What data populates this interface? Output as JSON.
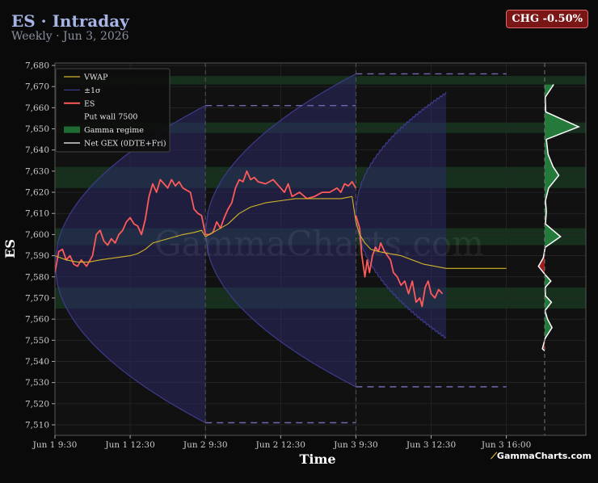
{
  "header": {
    "title": "ES · Intraday",
    "subtitle": "Weekly · Jun 3, 2026",
    "change_badge": "CHG -0.50%"
  },
  "watermark": "GammaCharts.com",
  "brand": {
    "spark": "⟋",
    "name": "GammaCharts.com"
  },
  "colors": {
    "background": "#0a0a0a",
    "plot_bg": "#111111",
    "price": "#ff5a5a",
    "vwap": "#d4b429",
    "sigma": "#3d3b8c",
    "sigma_fill": "#2c2a66",
    "gamma": "#1f6b34",
    "gex_pos": "#237a3a",
    "gex_neg": "#a01c1c"
  },
  "chart_data": {
    "type": "line",
    "xlabel": "Time",
    "ylabel": "ES",
    "ylim": [
      7505,
      7683
    ],
    "y_ticks": [
      7510,
      7520,
      7530,
      7540,
      7550,
      7560,
      7570,
      7580,
      7590,
      7600,
      7610,
      7620,
      7630,
      7640,
      7650,
      7660,
      7670,
      7680
    ],
    "x_ticks": [
      {
        "label": "Jun 1 9:30",
        "t": 0
      },
      {
        "label": "Jun 1 12:30",
        "t": 1
      },
      {
        "label": "Jun 2 9:30",
        "t": 2
      },
      {
        "label": "Jun 2 12:30",
        "t": 3
      },
      {
        "label": "Jun 3 9:30",
        "t": 4
      },
      {
        "label": "Jun 3 12:30",
        "t": 5
      },
      {
        "label": "Jun 3 16:00",
        "t": 6
      }
    ],
    "grid": true,
    "legend": {
      "position": "top-left",
      "entries": [
        {
          "label": "VWAP",
          "kind": "line",
          "color": "#d4b429"
        },
        {
          "label": "±1σ",
          "kind": "line",
          "color": "#3d3b8c"
        },
        {
          "label": "ES",
          "kind": "line",
          "color": "#ff5a5a"
        },
        {
          "label": "Put wall 7500",
          "kind": "none",
          "color": "#000000"
        },
        {
          "label": "Gamma regime",
          "kind": "patch",
          "color": "#1f6b34"
        },
        {
          "label": "Net GEX (0DTE+Fri)",
          "kind": "line",
          "color": "#ffffff"
        }
      ]
    },
    "session_breaks": [
      2,
      4
    ],
    "gamma_bands": [
      [
        7671,
        7675
      ],
      [
        7648,
        7653
      ],
      [
        7622,
        7632
      ],
      [
        7595,
        7603
      ],
      [
        7565,
        7575
      ]
    ],
    "sigma_cones": [
      {
        "t0": 0,
        "t1": 2,
        "center": 7586,
        "upper_end": 7661,
        "lower_end": 7511
      },
      {
        "t0": 2,
        "t1": 4,
        "center": 7601,
        "upper_end": 7676,
        "lower_end": 7528
      },
      {
        "t0": 4,
        "t1": 5.2,
        "center": 7610,
        "upper_end": 7667,
        "lower_end": 7551
      }
    ],
    "sigma_levels": [
      {
        "t0": 2,
        "t1": 4,
        "value": 7661
      },
      {
        "t0": 2,
        "t1": 4,
        "value": 7511
      },
      {
        "t0": 4,
        "t1": 6,
        "value": 7676
      },
      {
        "t0": 4,
        "t1": 6,
        "value": 7528
      }
    ],
    "series": [
      {
        "name": "ES",
        "points": [
          [
            0,
            7582
          ],
          [
            0.05,
            7592
          ],
          [
            0.1,
            7593
          ],
          [
            0.15,
            7588
          ],
          [
            0.2,
            7590
          ],
          [
            0.25,
            7586
          ],
          [
            0.3,
            7585
          ],
          [
            0.35,
            7588
          ],
          [
            0.42,
            7585
          ],
          [
            0.5,
            7590
          ],
          [
            0.55,
            7600
          ],
          [
            0.6,
            7602
          ],
          [
            0.65,
            7597
          ],
          [
            0.7,
            7595
          ],
          [
            0.75,
            7598
          ],
          [
            0.8,
            7596
          ],
          [
            0.85,
            7600
          ],
          [
            0.9,
            7602
          ],
          [
            0.95,
            7606
          ],
          [
            1.0,
            7608
          ],
          [
            1.05,
            7605
          ],
          [
            1.1,
            7604
          ],
          [
            1.15,
            7600
          ],
          [
            1.2,
            7607
          ],
          [
            1.25,
            7618
          ],
          [
            1.3,
            7624
          ],
          [
            1.35,
            7620
          ],
          [
            1.4,
            7626
          ],
          [
            1.45,
            7624
          ],
          [
            1.5,
            7622
          ],
          [
            1.55,
            7626
          ],
          [
            1.6,
            7623
          ],
          [
            1.65,
            7625
          ],
          [
            1.7,
            7622
          ],
          [
            1.8,
            7620
          ],
          [
            1.85,
            7612
          ],
          [
            1.9,
            7610
          ],
          [
            1.95,
            7609
          ],
          [
            2.0,
            7600
          ],
          [
            2.05,
            7600
          ],
          [
            2.1,
            7601
          ],
          [
            2.15,
            7606
          ],
          [
            2.2,
            7603
          ],
          [
            2.25,
            7608
          ],
          [
            2.3,
            7612
          ],
          [
            2.35,
            7615
          ],
          [
            2.4,
            7622
          ],
          [
            2.45,
            7626
          ],
          [
            2.5,
            7625
          ],
          [
            2.55,
            7630
          ],
          [
            2.6,
            7626
          ],
          [
            2.65,
            7627
          ],
          [
            2.7,
            7625
          ],
          [
            2.8,
            7624
          ],
          [
            2.9,
            7626
          ],
          [
            3.0,
            7622
          ],
          [
            3.05,
            7620
          ],
          [
            3.1,
            7624
          ],
          [
            3.15,
            7618
          ],
          [
            3.25,
            7620
          ],
          [
            3.35,
            7617
          ],
          [
            3.45,
            7618
          ],
          [
            3.55,
            7620
          ],
          [
            3.65,
            7620
          ],
          [
            3.75,
            7622
          ],
          [
            3.8,
            7620
          ],
          [
            3.85,
            7624
          ],
          [
            3.9,
            7623
          ],
          [
            3.95,
            7625
          ],
          [
            4.0,
            7622
          ],
          [
            4.0,
            7609
          ],
          [
            4.05,
            7603
          ],
          [
            4.08,
            7590
          ],
          [
            4.12,
            7580
          ],
          [
            4.15,
            7588
          ],
          [
            4.18,
            7582
          ],
          [
            4.22,
            7590
          ],
          [
            4.26,
            7594
          ],
          [
            4.3,
            7592
          ],
          [
            4.33,
            7596
          ],
          [
            4.38,
            7592
          ],
          [
            4.42,
            7590
          ],
          [
            4.46,
            7588
          ],
          [
            4.5,
            7582
          ],
          [
            4.55,
            7580
          ],
          [
            4.6,
            7576
          ],
          [
            4.65,
            7578
          ],
          [
            4.7,
            7572
          ],
          [
            4.75,
            7578
          ],
          [
            4.8,
            7568
          ],
          [
            4.85,
            7570
          ],
          [
            4.88,
            7566
          ],
          [
            4.92,
            7575
          ],
          [
            4.96,
            7578
          ],
          [
            5.0,
            7572
          ],
          [
            5.05,
            7570
          ],
          [
            5.1,
            7574
          ],
          [
            5.15,
            7572
          ]
        ]
      },
      {
        "name": "VWAP",
        "points": [
          [
            0,
            7590
          ],
          [
            0.15,
            7588
          ],
          [
            0.3,
            7587
          ],
          [
            0.45,
            7587
          ],
          [
            0.6,
            7588
          ],
          [
            0.8,
            7589
          ],
          [
            1.0,
            7590
          ],
          [
            1.1,
            7591
          ],
          [
            1.2,
            7593
          ],
          [
            1.3,
            7596
          ],
          [
            1.5,
            7598
          ],
          [
            1.7,
            7600
          ],
          [
            1.85,
            7601
          ],
          [
            1.95,
            7602
          ],
          [
            2.0,
            7599
          ],
          [
            2.15,
            7602
          ],
          [
            2.3,
            7605
          ],
          [
            2.45,
            7610
          ],
          [
            2.6,
            7613
          ],
          [
            2.8,
            7615
          ],
          [
            3.0,
            7616
          ],
          [
            3.2,
            7617
          ],
          [
            3.4,
            7617
          ],
          [
            3.6,
            7617
          ],
          [
            3.8,
            7617
          ],
          [
            3.95,
            7618
          ],
          [
            4.0,
            7606
          ],
          [
            4.05,
            7600
          ],
          [
            4.12,
            7596
          ],
          [
            4.2,
            7593
          ],
          [
            4.3,
            7592
          ],
          [
            4.45,
            7591
          ],
          [
            4.6,
            7590
          ],
          [
            4.75,
            7588
          ],
          [
            4.9,
            7586
          ],
          [
            5.05,
            7585
          ],
          [
            5.2,
            7584
          ],
          [
            5.5,
            7584
          ],
          [
            5.8,
            7584
          ],
          [
            6.0,
            7584
          ]
        ]
      }
    ],
    "net_gex": [
      [
        7671,
        3.2
      ],
      [
        7665,
        0.2
      ],
      [
        7658,
        0.4
      ],
      [
        7651,
        12
      ],
      [
        7645,
        0.6
      ],
      [
        7638,
        1.2
      ],
      [
        7632,
        3.0
      ],
      [
        7628,
        5.0
      ],
      [
        7622,
        1.4
      ],
      [
        7616,
        0.3
      ],
      [
        7611,
        0.6
      ],
      [
        7605,
        0.3
      ],
      [
        7599,
        5.6
      ],
      [
        7594,
        0.2
      ],
      [
        7589,
        -0.5
      ],
      [
        7585,
        -2.2
      ],
      [
        7581,
        0.2
      ],
      [
        7578,
        2.2
      ],
      [
        7575,
        0.2
      ],
      [
        7571,
        0.3
      ],
      [
        7568,
        2.4
      ],
      [
        7564,
        0.1
      ],
      [
        7560,
        1.0
      ],
      [
        7556,
        2.6
      ],
      [
        7551,
        0.2
      ],
      [
        7546,
        -0.8
      ],
      [
        7545,
        0
      ]
    ]
  }
}
